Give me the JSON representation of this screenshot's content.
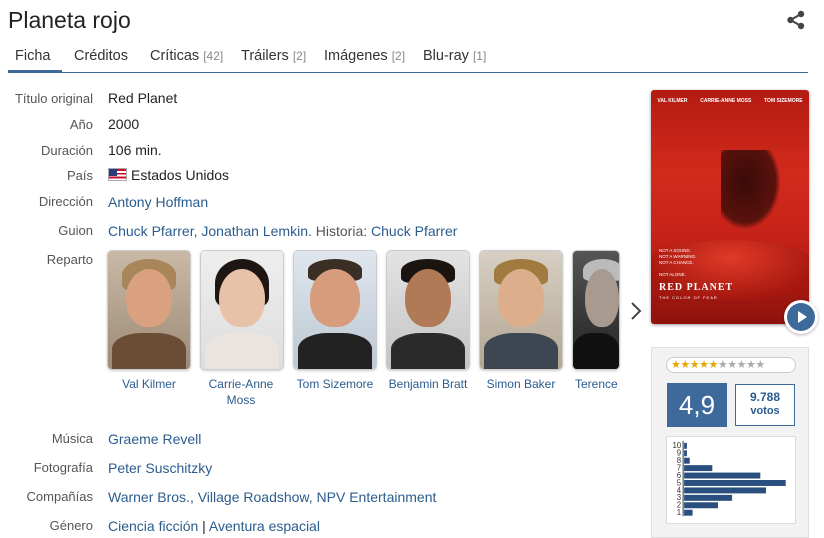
{
  "title": "Planeta rojo",
  "tabs": [
    {
      "label": "Ficha",
      "count": ""
    },
    {
      "label": "Créditos",
      "count": ""
    },
    {
      "label": "Críticas",
      "count": "[42]"
    },
    {
      "label": "Tráilers",
      "count": "[2]"
    },
    {
      "label": "Imágenes",
      "count": "[2]"
    },
    {
      "label": "Blu-ray",
      "count": "[1]"
    }
  ],
  "details": {
    "titulo_label": "Título original",
    "titulo": "Red Planet",
    "anio_label": "Año",
    "anio": "2000",
    "duracion_label": "Duración",
    "duracion": "106 min.",
    "pais_label": "País",
    "pais": "Estados Unidos",
    "direccion_label": "Dirección",
    "direccion": "Antony Hoffman",
    "guion_label": "Guion",
    "guion_link": "Chuck Pfarrer, Jonathan Lemkin.",
    "historia_label": "Historia:",
    "historia": "Chuck Pfarrer",
    "reparto_label": "Reparto",
    "musica_label": "Música",
    "musica": "Graeme Revell",
    "fotografia_label": "Fotografía",
    "fotografia": "Peter Suschitzky",
    "companias_label": "Compañías",
    "companias": "Warner Bros., Village Roadshow, NPV Entertainment",
    "genero_label": "Género",
    "genero_1": "Ciencia ficción",
    "genero_sep": "|",
    "genero_2": "Aventura espacial"
  },
  "cast": [
    {
      "name": "Val Kilmer",
      "name2": ""
    },
    {
      "name": "Carrie-Anne",
      "name2": "Moss"
    },
    {
      "name": "Tom Sizemore",
      "name2": ""
    },
    {
      "name": "Benjamin Bratt",
      "name2": ""
    },
    {
      "name": "Simon Baker",
      "name2": ""
    },
    {
      "name": "Terence",
      "name2": ""
    }
  ],
  "poster": {
    "credits": [
      "VAL KILMER",
      "CARRIE-ANNE MOSS",
      "TOM SIZEMORE"
    ],
    "tagline": [
      "NOT A SOUND.",
      "NOT A WARNING.",
      "NOT A CHANCE.",
      "",
      "NOT ALONE."
    ],
    "title": "RED PLANET",
    "subtitle": "THE COLOR OF FEAR"
  },
  "rating": {
    "stars": 5,
    "stars_total": 10,
    "average": "4,9",
    "votes_count": "9.788",
    "votes_label": "votos"
  },
  "chart_data": {
    "type": "bar",
    "orientation": "horizontal",
    "categories": [
      "10",
      "9",
      "8",
      "7",
      "6",
      "5",
      "4",
      "3",
      "2",
      "1"
    ],
    "values": [
      1,
      1,
      2,
      10,
      27,
      36,
      29,
      17,
      12,
      3
    ]
  }
}
